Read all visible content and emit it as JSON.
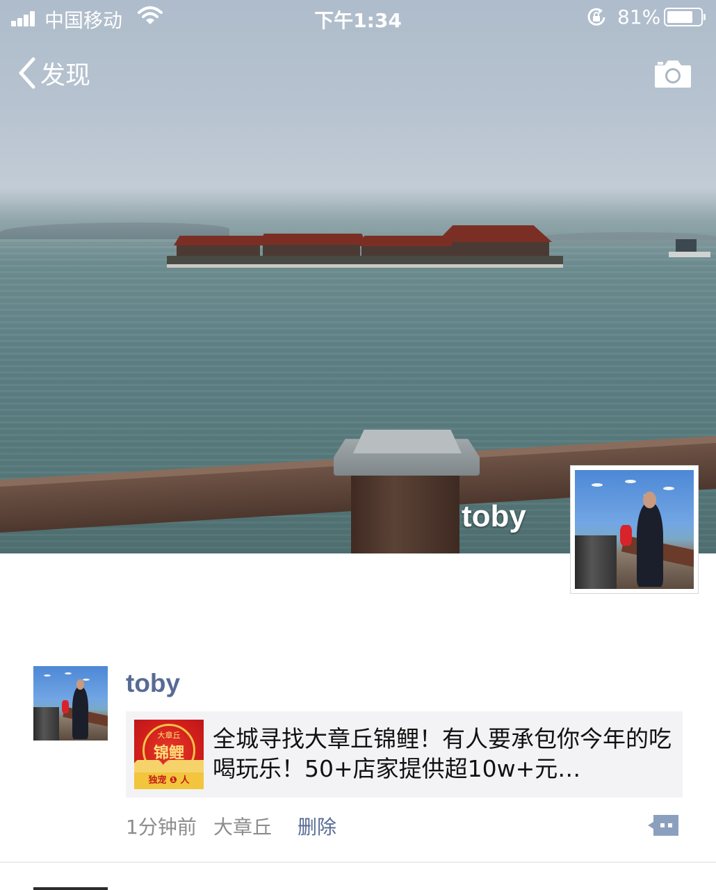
{
  "status_bar": {
    "carrier": "中国移动",
    "time": "下午1:34",
    "battery_percent": "81%",
    "battery_level": 0.81
  },
  "nav": {
    "back_label": "发现",
    "camera_icon": "camera-icon"
  },
  "cover": {
    "user_name": "toby"
  },
  "post": {
    "author": "toby",
    "share": {
      "thumbnail_lines": [
        "大章丘",
        "锦鲤",
        "独宠 ❶ 人"
      ],
      "title": "全城寻找大章丘锦鲤！有人要承包你今年的吃喝玩乐！50+店家提供超10w+元…"
    },
    "time": "1分钟前",
    "location": "大章丘",
    "delete_label": "删除"
  },
  "colors": {
    "link_blue": "#576b95",
    "meta_gray": "#8c8c8c",
    "card_bg": "#f3f3f5"
  }
}
